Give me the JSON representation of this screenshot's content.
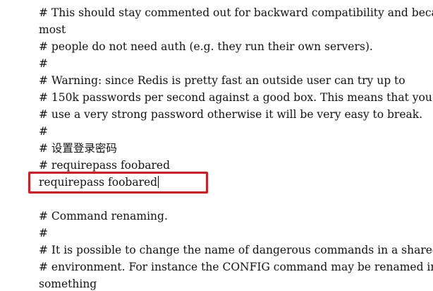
{
  "editor": {
    "lines": [
      "# This should stay commented out for backward compatibility and because",
      "most",
      "# people do not need auth (e.g. they run their own servers).",
      "#",
      "# Warning: since Redis is pretty fast an outside user can try up to",
      "# 150k passwords per second against a good box. This means that you should",
      "# use a very strong password otherwise it will be very easy to break.",
      "#",
      "# 设置登录密码",
      "# requirepass foobared",
      "requirepass foobared",
      "",
      "# Command renaming.",
      "#",
      "# It is possible to change the name of dangerous commands in a shared",
      "# environment. For instance the CONFIG command may be renamed into",
      "something"
    ],
    "highlight_color": "#e8141b"
  }
}
